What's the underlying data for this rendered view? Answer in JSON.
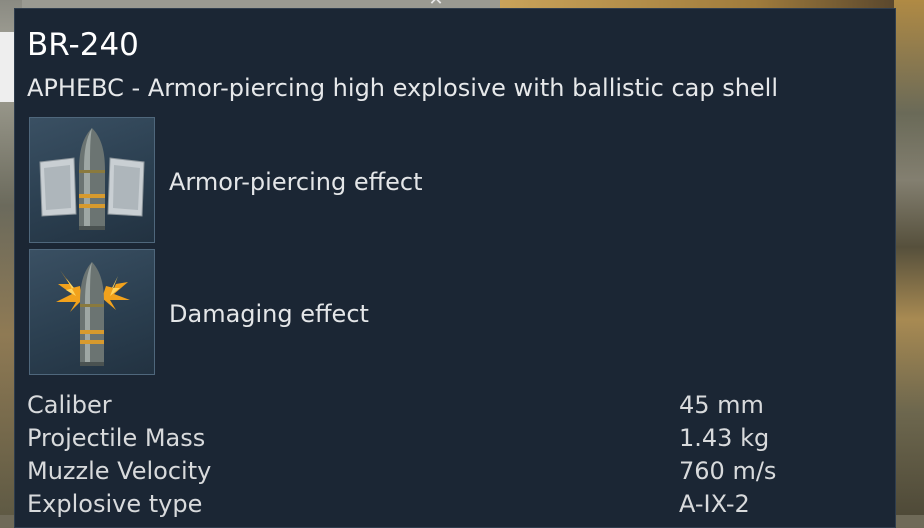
{
  "tooltip": {
    "title": "BR-240",
    "subtitle": "APHEBC - Armor-piercing high explosive with ballistic cap shell",
    "effects": [
      {
        "label": "Armor-piercing effect",
        "icon": "armor-piercing-shell-icon"
      },
      {
        "label": "Damaging effect",
        "icon": "explosive-shell-icon"
      }
    ],
    "stats": [
      {
        "name": "Caliber",
        "value": "45 mm"
      },
      {
        "name": "Projectile Mass",
        "value": "1.43 kg"
      },
      {
        "name": "Muzzle Velocity",
        "value": "760 m/s"
      },
      {
        "name": "Explosive type",
        "value": "A-IX-2"
      }
    ]
  },
  "colors": {
    "panel_background": "#1b2634",
    "title_text": "#ffffff",
    "body_text": "#d8dadc",
    "shell_band": "#d79a2e",
    "blast": "#f2a21c"
  }
}
